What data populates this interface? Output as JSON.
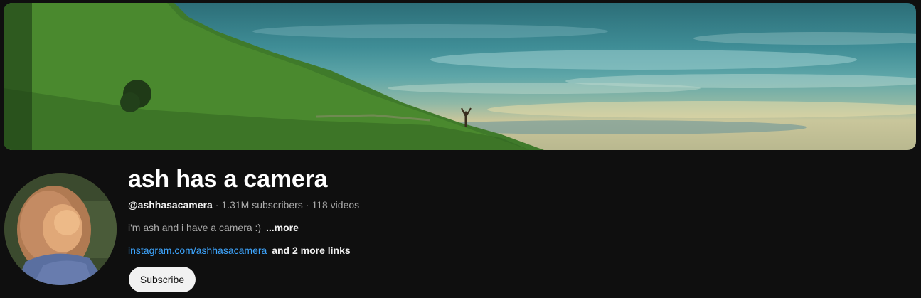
{
  "channel": {
    "name": "ash has a camera",
    "handle": "@ashhasacamera",
    "separator": "·",
    "subscribers": "1.31M subscribers",
    "videos": "118 videos",
    "description": "i'm ash and i have a camera :)",
    "description_more": "...more",
    "link": "instagram.com/ashhasacamera",
    "more_links": "and 2 more links",
    "subscribe_label": "Subscribe"
  },
  "colors": {
    "background": "#0f0f0f",
    "link": "#3ea6ff",
    "subscribe_bg": "#f1f1f1"
  }
}
